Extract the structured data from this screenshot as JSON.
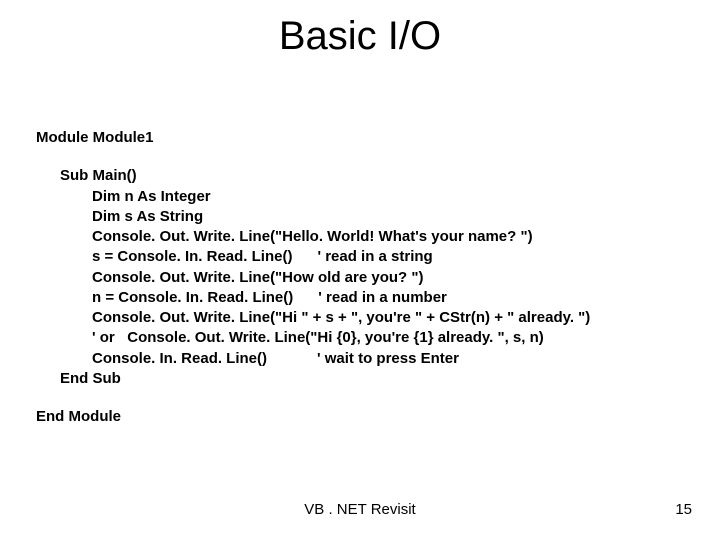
{
  "title": "Basic I/O",
  "module_start": "Module Module1",
  "sub_start": "Sub Main()",
  "lines": [
    "Dim n As Integer",
    "Dim s As String",
    "Console. Out. Write. Line(\"Hello. World! What's your name? \")",
    "s = Console. In. Read. Line()      ' read in a string",
    "Console. Out. Write. Line(\"How old are you? \")",
    "n = Console. In. Read. Line()      ' read in a number",
    "Console. Out. Write. Line(\"Hi \" + s + \", you're \" + CStr(n) + \" already. \")",
    "' or   Console. Out. Write. Line(\"Hi {0}, you're {1} already. \", s, n)",
    "Console. In. Read. Line()            ' wait to press Enter"
  ],
  "sub_end": "End Sub",
  "module_end": "End Module",
  "footer_center": "VB . NET Revisit",
  "footer_right": "15"
}
